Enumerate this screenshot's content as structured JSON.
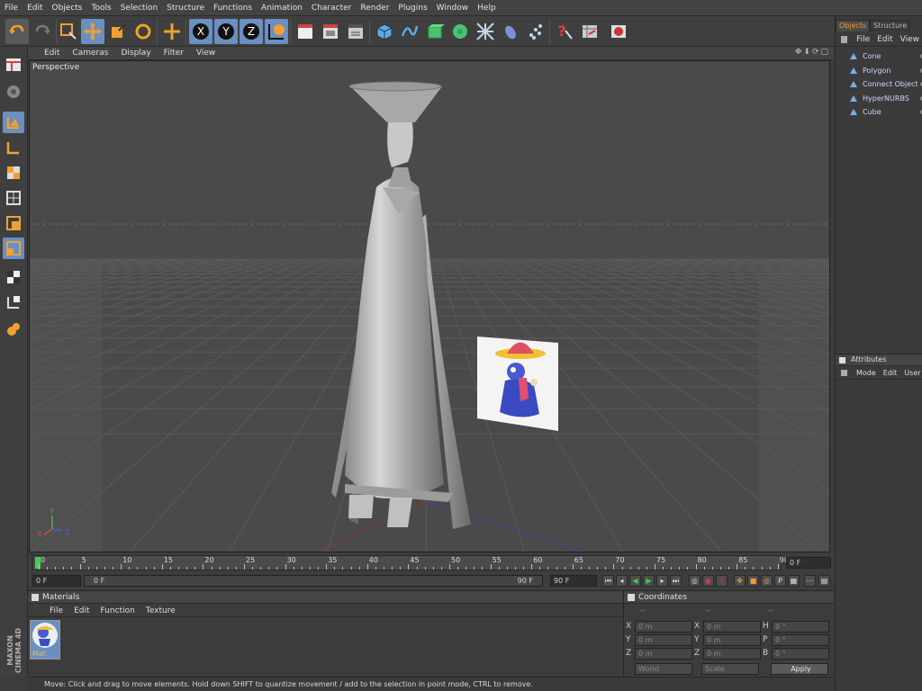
{
  "menubar": {
    "items": [
      "File",
      "Edit",
      "Objects",
      "Tools",
      "Selection",
      "Structure",
      "Functions",
      "Animation",
      "Character",
      "Render",
      "Plugins",
      "Window",
      "Help"
    ]
  },
  "viewport": {
    "menu": [
      "Edit",
      "Cameras",
      "Display",
      "Filter",
      "View"
    ],
    "label": "Perspective",
    "axes": {
      "y": "Y",
      "x": "X",
      "z": "Z"
    }
  },
  "timeline": {
    "ticks": [
      "0",
      "5",
      "10",
      "15",
      "20",
      "25",
      "30",
      "35",
      "40",
      "45",
      "50",
      "55",
      "60",
      "65",
      "70",
      "75",
      "80",
      "85",
      "90"
    ],
    "current": "0 F"
  },
  "transport": {
    "start": "0 F",
    "range_start": "0 F",
    "range_end": "90 F",
    "end": "90 F"
  },
  "materials": {
    "title": "Materials",
    "menu": [
      "File",
      "Edit",
      "Function",
      "Texture"
    ],
    "items": [
      {
        "label": "Mat"
      }
    ]
  },
  "coordinates": {
    "title": "Coordinates",
    "dashes": [
      "--",
      "--",
      "--"
    ],
    "rows": [
      {
        "a": "X",
        "av": "0 m",
        "b": "X",
        "bv": "0 m",
        "c": "H",
        "cv": "0 °"
      },
      {
        "a": "Y",
        "av": "0 m",
        "b": "Y",
        "bv": "0 m",
        "c": "P",
        "cv": "0 °"
      },
      {
        "a": "Z",
        "av": "0 m",
        "b": "Z",
        "bv": "0 m",
        "c": "B",
        "cv": "0 °"
      }
    ],
    "mode": "World",
    "size_mode": "Scale",
    "apply": "Apply"
  },
  "status": "Move: Click and drag to move elements. Hold down SHIFT to quantize movement / add to the selection in point mode, CTRL to remove.",
  "objects": {
    "tabs": [
      "Objects",
      "Structure"
    ],
    "menu": [
      "File",
      "Edit",
      "View"
    ],
    "items": [
      "Cone",
      "Polygon",
      "Connect Object",
      "HyperNURBS",
      "Cube"
    ]
  },
  "attributes": {
    "title": "Attributes",
    "menu": [
      "Mode",
      "Edit",
      "User"
    ]
  },
  "brand": {
    "line1": "MAXON",
    "line2": "CINEMA 4D"
  },
  "colors": {
    "accent": "#f0a030",
    "select": "#6a8fc0"
  }
}
